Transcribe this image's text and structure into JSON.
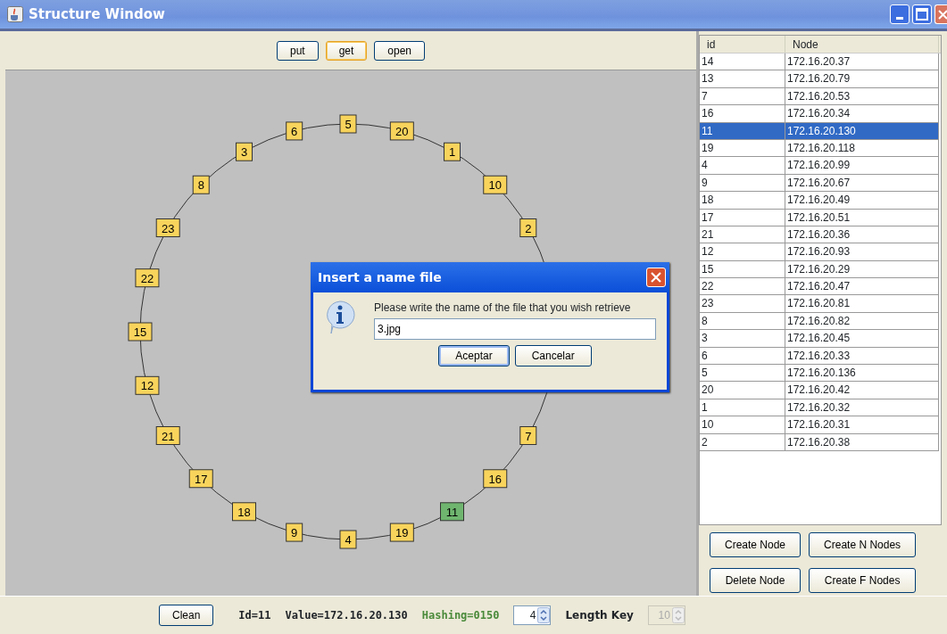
{
  "window": {
    "title": "Structure Window"
  },
  "toolbar": {
    "buttons": [
      {
        "label": "put",
        "focused": false
      },
      {
        "label": "get",
        "focused": true
      },
      {
        "label": "open",
        "focused": false
      }
    ]
  },
  "ring": {
    "nodes": [
      {
        "label": "5",
        "selected": false
      },
      {
        "label": "20",
        "selected": false
      },
      {
        "label": "1",
        "selected": false
      },
      {
        "label": "10",
        "selected": false
      },
      {
        "label": "2",
        "selected": false
      },
      {
        "label": "7",
        "selected": false
      },
      {
        "label": "16",
        "selected": false
      },
      {
        "label": "11",
        "selected": true
      },
      {
        "label": "19",
        "selected": false
      },
      {
        "label": "4",
        "selected": false
      },
      {
        "label": "9",
        "selected": false
      },
      {
        "label": "18",
        "selected": false
      },
      {
        "label": "17",
        "selected": false
      },
      {
        "label": "21",
        "selected": false
      },
      {
        "label": "12",
        "selected": false
      },
      {
        "label": "15",
        "selected": false
      },
      {
        "label": "22",
        "selected": false
      },
      {
        "label": "23",
        "selected": false
      },
      {
        "label": "8",
        "selected": false
      },
      {
        "label": "3",
        "selected": false
      },
      {
        "label": "6",
        "selected": false
      }
    ]
  },
  "dialog": {
    "title": "Insert a name file",
    "message": "Please write the name of the file that you wish retrieve",
    "value": "3.jpg",
    "buttons": [
      {
        "label": "Aceptar",
        "focused": true
      },
      {
        "label": "Cancelar",
        "focused": false
      }
    ]
  },
  "table": {
    "columns": [
      "id",
      "Node"
    ],
    "rows": [
      {
        "id": "14",
        "node": "172.16.20.37",
        "selected": false
      },
      {
        "id": "13",
        "node": "172.16.20.79",
        "selected": false
      },
      {
        "id": "7",
        "node": "172.16.20.53",
        "selected": false
      },
      {
        "id": "16",
        "node": "172.16.20.34",
        "selected": false
      },
      {
        "id": "11",
        "node": "172.16.20.130",
        "selected": true
      },
      {
        "id": "19",
        "node": "172.16.20.118",
        "selected": false
      },
      {
        "id": "4",
        "node": "172.16.20.99",
        "selected": false
      },
      {
        "id": "9",
        "node": "172.16.20.67",
        "selected": false
      },
      {
        "id": "18",
        "node": "172.16.20.49",
        "selected": false
      },
      {
        "id": "17",
        "node": "172.16.20.51",
        "selected": false
      },
      {
        "id": "21",
        "node": "172.16.20.36",
        "selected": false
      },
      {
        "id": "12",
        "node": "172.16.20.93",
        "selected": false
      },
      {
        "id": "15",
        "node": "172.16.20.29",
        "selected": false
      },
      {
        "id": "22",
        "node": "172.16.20.47",
        "selected": false
      },
      {
        "id": "23",
        "node": "172.16.20.81",
        "selected": false
      },
      {
        "id": "8",
        "node": "172.16.20.82",
        "selected": false
      },
      {
        "id": "3",
        "node": "172.16.20.45",
        "selected": false
      },
      {
        "id": "6",
        "node": "172.16.20.33",
        "selected": false
      },
      {
        "id": "5",
        "node": "172.16.20.136",
        "selected": false
      },
      {
        "id": "20",
        "node": "172.16.20.42",
        "selected": false
      },
      {
        "id": "1",
        "node": "172.16.20.32",
        "selected": false
      },
      {
        "id": "10",
        "node": "172.16.20.31",
        "selected": false
      },
      {
        "id": "2",
        "node": "172.16.20.38",
        "selected": false
      }
    ]
  },
  "node_buttons": [
    "Create Node",
    "Create N Nodes",
    "Delete Node",
    "Create F Nodes"
  ],
  "status_bar": {
    "clean_button": "Clean",
    "id": "Id=11",
    "value": "Value=172.16.20.130",
    "hashing": "Hashing=0150",
    "spinner": {
      "value": "4",
      "disabled": false
    },
    "length_label": "Length Key",
    "length_spinner": {
      "value": "10",
      "disabled": true
    }
  }
}
